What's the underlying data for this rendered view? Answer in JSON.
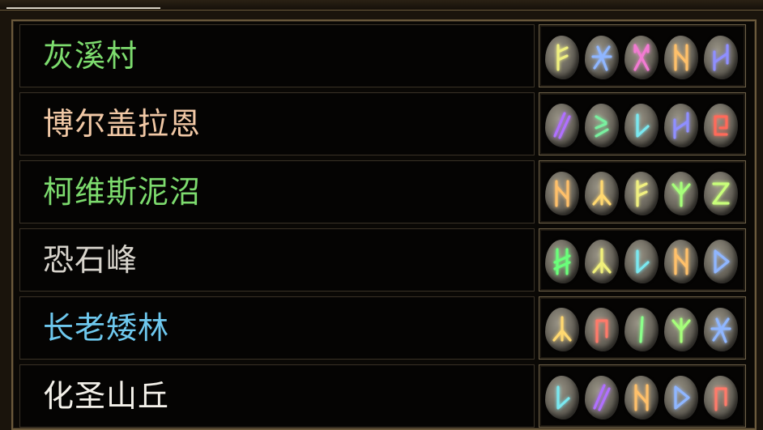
{
  "runes": {
    "y_arrow": {
      "color": "#f0f080",
      "icon": "rune-arrow-icon"
    },
    "b_cross": {
      "color": "#8fb6ff",
      "icon": "rune-cross-icon"
    },
    "p_x": {
      "color": "#f27bd2",
      "icon": "rune-x-icon"
    },
    "o_n": {
      "color": "#ffc06a",
      "icon": "rune-n-icon"
    },
    "b_h": {
      "color": "#8f8fff",
      "icon": "rune-h-icon"
    },
    "p_slash": {
      "color": "#b070ff",
      "icon": "rune-double-slash-icon"
    },
    "g_zig": {
      "color": "#7af0a0",
      "icon": "rune-zig-icon"
    },
    "c_v": {
      "color": "#7ae8f0",
      "icon": "rune-v-icon"
    },
    "r_curl": {
      "color": "#ff6a5a",
      "icon": "rune-curl-icon"
    },
    "o_lambda": {
      "color": "#ffd870",
      "icon": "rune-lambda-icon"
    },
    "y_lambda": {
      "color": "#f0f07a",
      "icon": "rune-lambda-icon"
    },
    "g_psi": {
      "color": "#a6ff7a",
      "icon": "rune-psi-icon"
    },
    "g_z": {
      "color": "#c8ff7a",
      "icon": "rune-z-icon"
    },
    "g_ladder": {
      "color": "#6aff7a",
      "icon": "rune-ladder-icon"
    },
    "b_tri": {
      "color": "#8fb6ff",
      "icon": "rune-triangle-icon"
    },
    "r_flag": {
      "color": "#ff7a6a",
      "icon": "rune-flag-icon"
    },
    "g_bar": {
      "color": "#8aff8a",
      "icon": "rune-bar-icon"
    }
  },
  "rows": [
    {
      "name": "灰溪村",
      "color": "#7ddc6e",
      "runes": [
        "y_arrow",
        "b_cross",
        "p_x",
        "o_n",
        "b_h"
      ]
    },
    {
      "name": "博尔盖拉恩",
      "color": "#f2c9a6",
      "runes": [
        "p_slash",
        "g_zig",
        "c_v",
        "b_h",
        "r_curl"
      ]
    },
    {
      "name": "柯维斯泥沼",
      "color": "#7ddc6e",
      "runes": [
        "o_n",
        "o_lambda",
        "y_arrow",
        "g_psi",
        "g_z"
      ]
    },
    {
      "name": "恐石峰",
      "color": "#d8d4cc",
      "runes": [
        "g_ladder",
        "y_lambda",
        "c_v",
        "o_n",
        "b_tri"
      ]
    },
    {
      "name": "长老矮林",
      "color": "#6ec8ee",
      "runes": [
        "o_lambda",
        "r_flag",
        "g_bar",
        "g_psi",
        "b_cross"
      ]
    },
    {
      "name": "化圣山丘",
      "color": "#f4f1ea",
      "runes": [
        "c_v",
        "p_slash",
        "o_n",
        "b_tri",
        "r_flag"
      ]
    }
  ]
}
